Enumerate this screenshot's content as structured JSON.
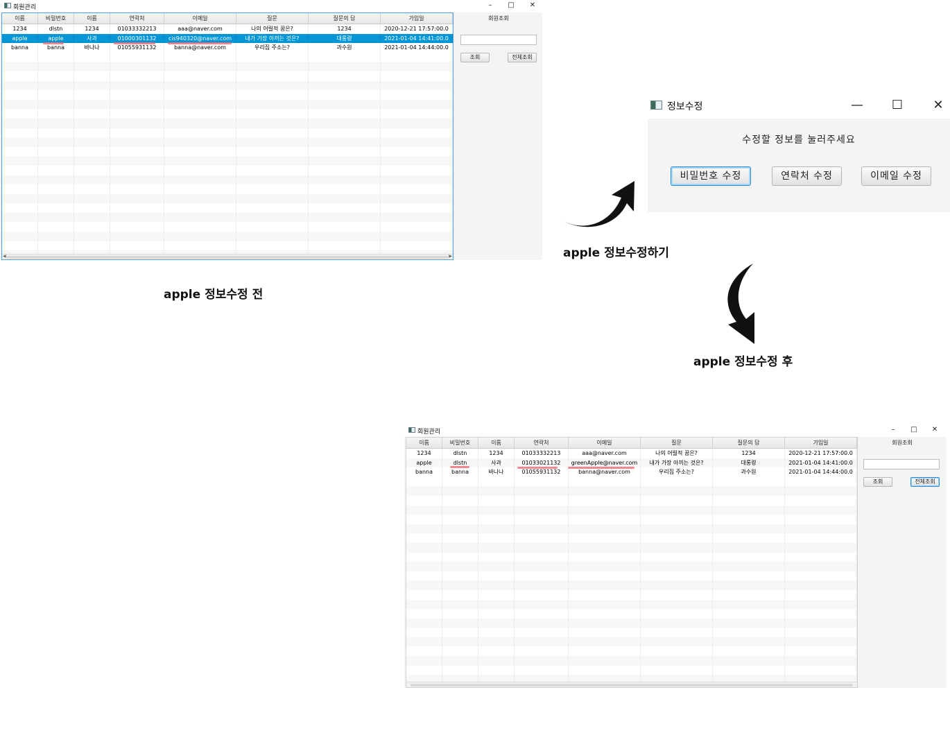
{
  "before_window": {
    "title": "회원관리",
    "controls": {
      "minimize": "–",
      "maximize": "□",
      "close": "✕"
    },
    "columns": [
      "이름",
      "비밀번호",
      "이름",
      "연락처",
      "이메일",
      "질문",
      "질문의 답",
      "가입일"
    ],
    "rows": [
      [
        "1234",
        "dlstn",
        "1234",
        "01033332213",
        "aaa@naver.com",
        "나의 어릴적 꿈은?",
        "1234",
        "2020-12-21 17:57:00.0"
      ],
      [
        "apple",
        "apple",
        "사과",
        "01000301132",
        "cis940320@naver.com",
        "내가 가장 아끼는 것은?",
        "대롱령",
        "2021-01-04 14:41:00.0"
      ],
      [
        "banna",
        "banna",
        "바나나",
        "01055931132",
        "banna@naver.com",
        "우리집 주소는?",
        "과수원",
        "2021-01-04 14:44:00.0"
      ]
    ],
    "selected_row": 1,
    "side_panel": {
      "title": "회원조회",
      "search_value": "",
      "query_button": "조회",
      "all_button": "전체조회"
    }
  },
  "after_window": {
    "title": "회원관리",
    "controls": {
      "minimize": "–",
      "maximize": "□",
      "close": "✕"
    },
    "columns": [
      "이름",
      "비밀번호",
      "이름",
      "연락처",
      "이메일",
      "질문",
      "질문의 답",
      "가입일"
    ],
    "rows": [
      [
        "1234",
        "dlstn",
        "1234",
        "01033332213",
        "aaa@naver.com",
        "나의 어릴적 꿈은?",
        "1234",
        "2020-12-21 17:57:00.0"
      ],
      [
        "apple",
        "dlstn",
        "사과",
        "01033021132",
        "greenApple@naver.com",
        "내가 가장 아끼는 것은?",
        "대롱령",
        "2021-01-04 14:41:00.0"
      ],
      [
        "banna",
        "banna",
        "바나나",
        "01055931132",
        "banna@naver.com",
        "우리집 주소는?",
        "과수원",
        "2021-01-04 14:44:00.0"
      ]
    ],
    "side_panel": {
      "title": "회원조회",
      "search_value": "",
      "query_button": "조회",
      "all_button": "전체조회"
    }
  },
  "dialog": {
    "title": "정보수정",
    "controls": {
      "minimize": "—",
      "maximize": "☐",
      "close": "✕"
    },
    "prompt": "수정할 정보를 눌러주세요",
    "buttons": [
      "비밀번호 수정",
      "연락처 수정",
      "이메일 수정"
    ]
  },
  "captions": {
    "before": "apple 정보수정 전",
    "edit": "apple 정보수정하기",
    "after": "apple 정보수정 후"
  },
  "colors": {
    "selection": "#0096d6",
    "focus_border": "#2a8fd8",
    "highlight_mark": "#ec6a78"
  }
}
